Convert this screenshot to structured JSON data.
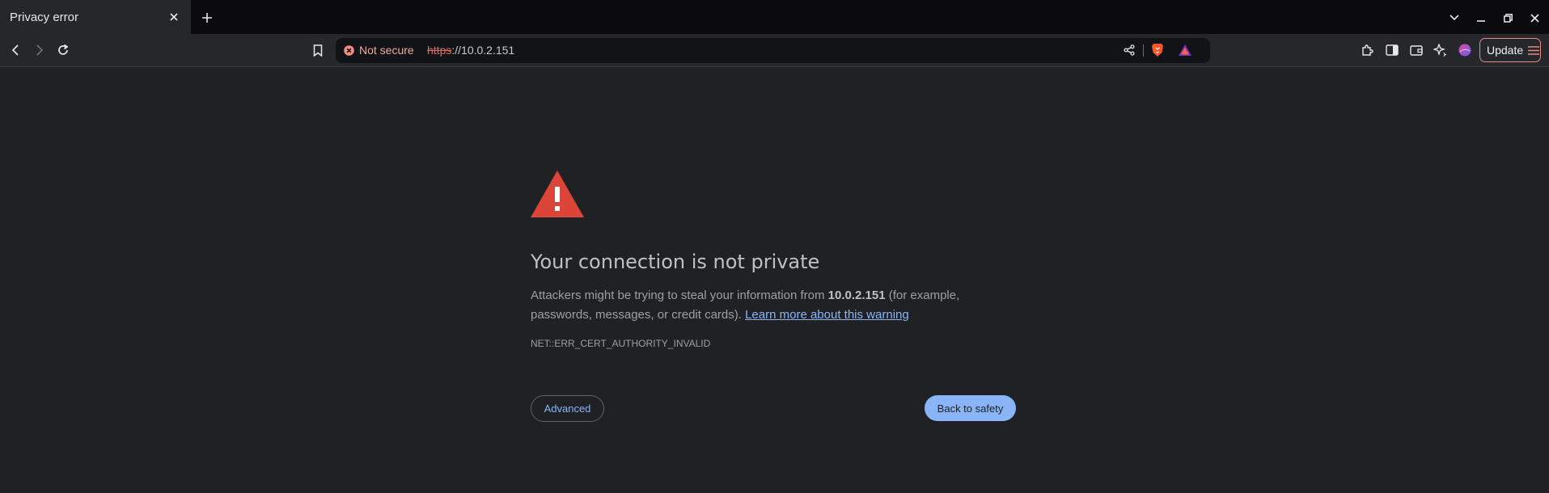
{
  "tab": {
    "title": "Privacy error"
  },
  "omnibox": {
    "security_label": "Not secure",
    "url_scheme": "https",
    "url_rest": "://10.0.2.151"
  },
  "toolbar": {
    "update_label": "Update"
  },
  "error_page": {
    "heading": "Your connection is not private",
    "desc_before": "Attackers might be trying to steal your information from ",
    "desc_host": "10.0.2.151",
    "desc_after": " (for example, passwords, messages, or credit cards). ",
    "learn_more": "Learn more about this warning",
    "error_code": "NET::ERR_CERT_AUTHORITY_INVALID",
    "advanced_label": "Advanced",
    "back_label": "Back to safety"
  },
  "colors": {
    "page_bg": "#202124",
    "warning_red": "#db4437",
    "link_blue": "#8ab4f8",
    "not_secure": "#f0a9a2"
  }
}
